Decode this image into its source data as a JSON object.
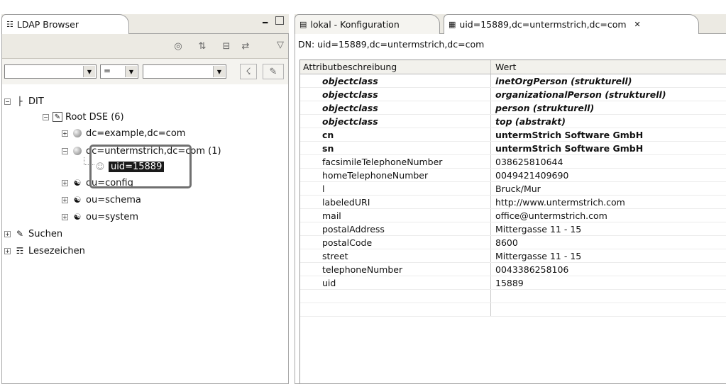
{
  "left_panel": {
    "title": "LDAP Browser",
    "filter": {
      "attribute_value": "",
      "operator_value": "=",
      "value_value": ""
    },
    "tree": {
      "dit": "DIT",
      "root_dse": "Root DSE (6)",
      "entry_example": "dc=example,dc=com",
      "entry_untermstrich": "dc=untermstrich,dc=com (1)",
      "entry_uid": "uid=15889",
      "entry_config": "ou=config",
      "entry_schema": "ou=schema",
      "entry_system": "ou=system",
      "search": "Suchen",
      "bookmarks": "Lesezeichen"
    }
  },
  "editor": {
    "tabs": [
      {
        "label": "lokal - Konfiguration"
      },
      {
        "label": "uid=15889,dc=untermstrich,dc=com"
      }
    ],
    "dn_line": "DN: uid=15889,dc=untermstrich,dc=com",
    "columns": [
      "Attributbeschreibung",
      "Wert"
    ],
    "rows": [
      {
        "attr": "objectclass",
        "value": "inetOrgPerson (strukturell)",
        "style": "bi"
      },
      {
        "attr": "objectclass",
        "value": "organizationalPerson (strukturell)",
        "style": "bi"
      },
      {
        "attr": "objectclass",
        "value": "person (strukturell)",
        "style": "bi"
      },
      {
        "attr": "objectclass",
        "value": "top (abstrakt)",
        "style": "bi"
      },
      {
        "attr": "cn",
        "value": "untermStrich Software GmbH",
        "style": "b"
      },
      {
        "attr": "sn",
        "value": "untermStrich Software GmbH",
        "style": "b"
      },
      {
        "attr": "facsimileTelephoneNumber",
        "value": "038625810644",
        "style": ""
      },
      {
        "attr": "homeTelephoneNumber",
        "value": "0049421409690",
        "style": ""
      },
      {
        "attr": "l",
        "value": "Bruck/Mur",
        "style": ""
      },
      {
        "attr": "labeledURI",
        "value": "http://www.untermstrich.com",
        "style": ""
      },
      {
        "attr": "mail",
        "value": "office@untermstrich.com",
        "style": ""
      },
      {
        "attr": "postalAddress",
        "value": "Mittergasse 11 - 15",
        "style": ""
      },
      {
        "attr": "postalCode",
        "value": "8600",
        "style": ""
      },
      {
        "attr": "street",
        "value": "Mittergasse 11 - 15",
        "style": ""
      },
      {
        "attr": "telephoneNumber",
        "value": "0043386258106",
        "style": ""
      },
      {
        "attr": "uid",
        "value": "15889",
        "style": ""
      },
      {
        "attr": "",
        "value": "",
        "style": ""
      },
      {
        "attr": "",
        "value": "",
        "style": ""
      }
    ]
  }
}
